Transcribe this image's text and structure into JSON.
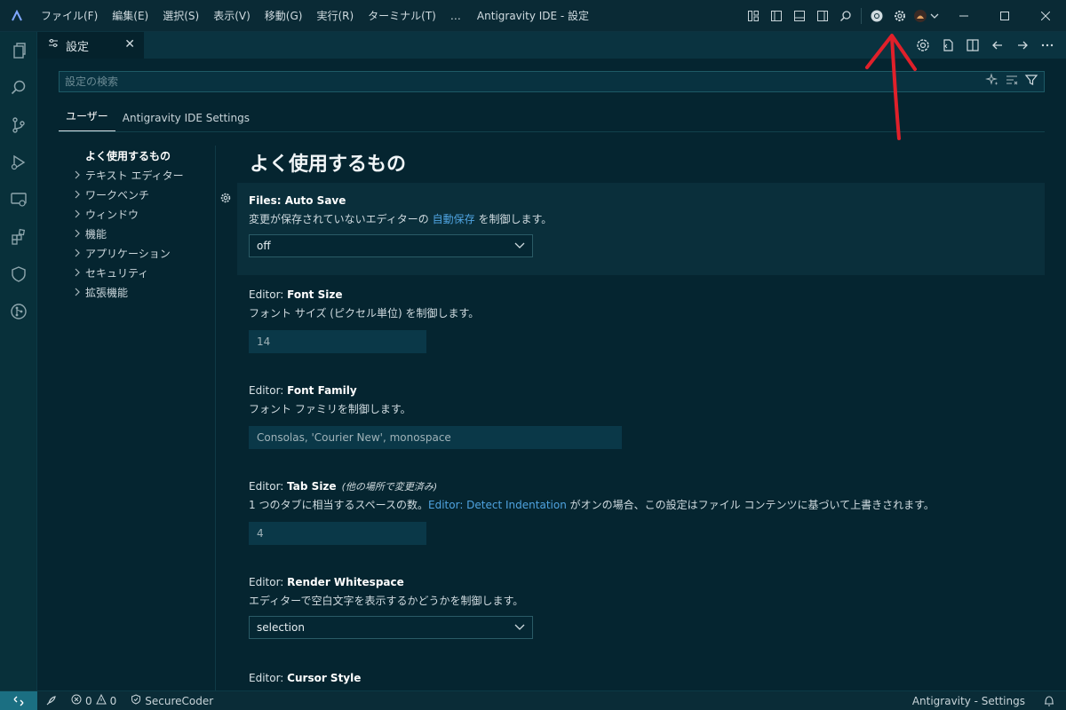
{
  "window": {
    "title": "Antigravity IDE - 設定",
    "menu": [
      "ファイル(F)",
      "編集(E)",
      "選択(S)",
      "表示(V)",
      "移動(G)",
      "実行(R)",
      "ターミナル(T)",
      "…"
    ]
  },
  "tab": {
    "label": "設定",
    "close": "✕"
  },
  "search": {
    "placeholder": "設定の検索"
  },
  "scopes": [
    "ユーザー",
    "Antigravity IDE Settings"
  ],
  "toc": [
    {
      "label": "よく使用するもの",
      "selected": true
    },
    {
      "label": "テキスト エディター"
    },
    {
      "label": "ワークベンチ"
    },
    {
      "label": "ウィンドウ"
    },
    {
      "label": "機能"
    },
    {
      "label": "アプリケーション"
    },
    {
      "label": "セキュリティ"
    },
    {
      "label": "拡張機能"
    }
  ],
  "section_title": "よく使用するもの",
  "settings": {
    "autosave": {
      "category": "Files: ",
      "name": "Auto Save",
      "desc_pre": "変更が保存されていないエディターの ",
      "desc_link": "自動保存",
      "desc_post": " を制御します。",
      "value": "off"
    },
    "fontsize": {
      "category": "Editor: ",
      "name": "Font Size",
      "desc": "フォント サイズ (ピクセル単位) を制御します。",
      "value": "14"
    },
    "fontfamily": {
      "category": "Editor: ",
      "name": "Font Family",
      "desc": "フォント ファミリを制御します。",
      "value": "Consolas, 'Courier New', monospace"
    },
    "tabsize": {
      "category": "Editor: ",
      "name": "Tab Size",
      "modified": "(他の場所で変更済み)",
      "desc_pre": "1 つのタブに相当するスペースの数。",
      "desc_link": "Editor: Detect Indentation",
      "desc_post": " がオンの場合、この設定はファイル コンテンツに基づいて上書きされます。",
      "value": "4"
    },
    "whitespace": {
      "category": "Editor: ",
      "name": "Render Whitespace",
      "desc": "エディターで空白文字を表示するかどうかを制御します。",
      "value": "selection"
    },
    "cursor": {
      "category": "Editor: ",
      "name": "Cursor Style"
    }
  },
  "status": {
    "errors": "0",
    "warnings": "0",
    "secure": "SecureCoder",
    "right_label": "Antigravity - Settings"
  },
  "colors": {
    "background": "#052530",
    "accent_link": "#4fa3e0",
    "annotation_arrow": "#e0202a"
  },
  "icons": [
    "app-logo-icon",
    "files-icon",
    "search-icon",
    "source-control-icon",
    "run-debug-icon",
    "remote-explorer-icon",
    "extensions-icon",
    "shield-icon",
    "git-graph-icon",
    "gear-icon",
    "chrome-icon",
    "account-icon"
  ]
}
